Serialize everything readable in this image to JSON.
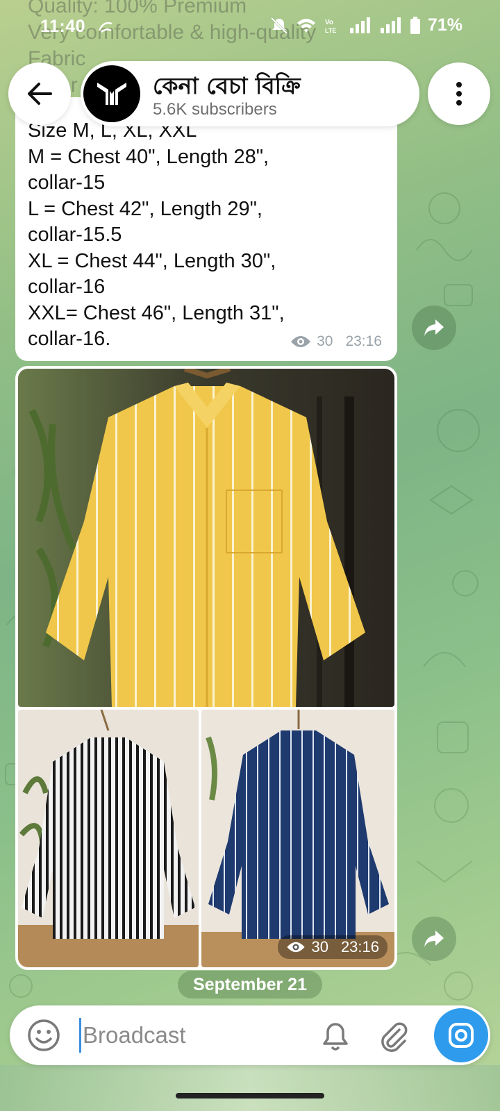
{
  "status_bar": {
    "time": "11:40",
    "battery": "71%",
    "icons": [
      "data-saver-icon",
      "mute-icon",
      "wifi-icon",
      "volte-icon",
      "signal-icon",
      "signal-icon",
      "battery-icon"
    ]
  },
  "ghost_text": [
    "Quality: 100% Premium",
    "Very comfortable & high-quality",
    "Fabric",
    "Color"
  ],
  "header": {
    "channel_name": "কেনা বেচা বিক্রি",
    "subscribers": "5.6K subscribers",
    "icons": [
      "back-arrow-icon",
      "channel-logo",
      "more-vertical-icon"
    ]
  },
  "messages": [
    {
      "type": "text",
      "lines": [
        "Size M, L, XL, XXL",
        "M = Chest 40\", Length 28\",",
        "collar-15",
        "L = Chest 42\", Length 29\",",
        "collar-15.5",
        "XL = Chest 44\", Length 30\",",
        "collar-16",
        "XXL= Chest 46\", Length 31\",",
        "collar-16."
      ],
      "views": "30",
      "time": "23:16"
    },
    {
      "type": "album",
      "photos": [
        "yellow-striped-shirt",
        "black-white-striped-shirt",
        "navy-striped-shirt"
      ],
      "views": "30",
      "time": "23:16"
    }
  ],
  "date_chip": "September 21",
  "input_bar": {
    "placeholder": "Broadcast",
    "icons": [
      "emoji-icon",
      "bell-icon",
      "attach-icon",
      "camera-icon"
    ]
  },
  "colors": {
    "accent": "#2e9bec",
    "bubble": "#ffffff",
    "meta_text": "#9aa3a9",
    "yellow_shirt": "#f0c74a",
    "navy_shirt": "#1e3a6e"
  }
}
